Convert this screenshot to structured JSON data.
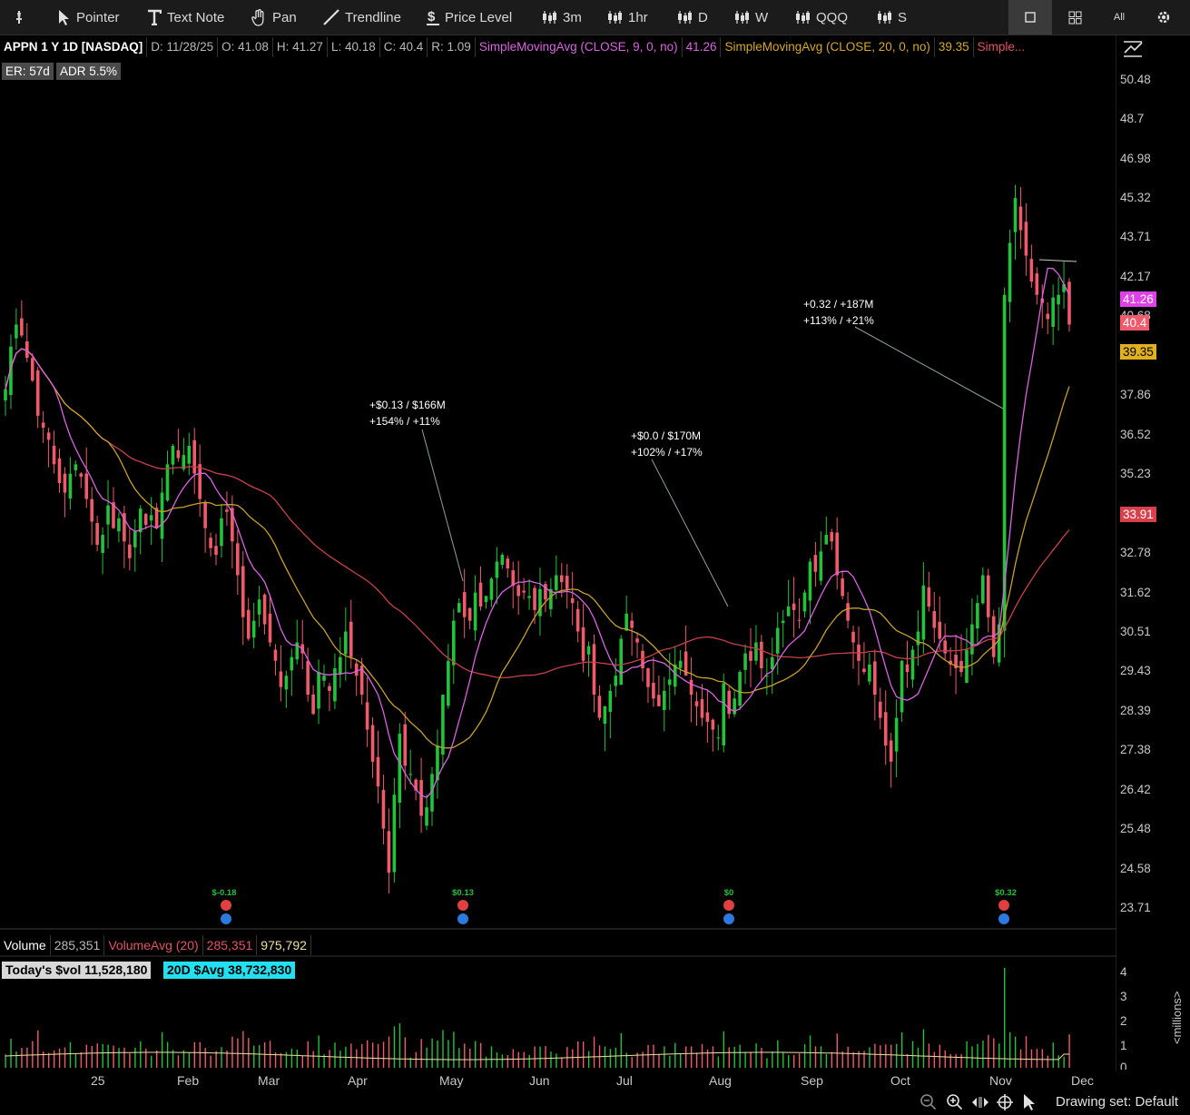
{
  "toolbar": {
    "pin_icon": "pin-icon",
    "pointer": "Pointer",
    "text_note": "Text Note",
    "pan": "Pan",
    "trendline": "Trendline",
    "price_level": "Price Level",
    "intervals": [
      "3m",
      "1hr",
      "D",
      "W",
      "QQQ",
      "S"
    ],
    "all_label": "All"
  },
  "info": {
    "symbol": "APPN 1 Y 1D [NASDAQ]",
    "date": "D: 11/28/25",
    "open": "O: 41.08",
    "high": "H: 41.27",
    "low": "L: 40.18",
    "close": "C: 40.4",
    "range": "R: 1.09",
    "sma9_label": "SimpleMovingAvg (CLOSE, 9, 0, no)",
    "sma9_value": "41.26",
    "sma20_label": "SimpleMovingAvg (CLOSE, 20, 0, no)",
    "sma20_value": "39.35",
    "sma50_label": "Simple...",
    "er": "ER: 57d",
    "adr": "ADR 5.5%"
  },
  "y_axis": [
    "50.48",
    "48.7",
    "46.98",
    "45.32",
    "43.71",
    "42.17",
    "40.68",
    "37.86",
    "36.52",
    "35.23",
    "32.78",
    "31.62",
    "30.51",
    "29.43",
    "28.39",
    "27.38",
    "26.42",
    "25.48",
    "24.58",
    "23.71"
  ],
  "price_tags": {
    "sma9": "41.26",
    "close": "40.4",
    "sma20": "39.35",
    "sma50": "33.91"
  },
  "annotations": [
    {
      "line1": "+$0.13 / $166M",
      "line2": "+154% / +11%"
    },
    {
      "line1": "+$0.0 / $170M",
      "line2": "+102% / +17%"
    },
    {
      "line1": "+0.32 / +187M",
      "line2": "+113% / +21%"
    }
  ],
  "earnings": [
    "$-0.18",
    "$0.13",
    "$0",
    "$0.32"
  ],
  "volume": {
    "label": "Volume",
    "value": "285,351",
    "avg_label": "VolumeAvg (20)",
    "avg_value": "285,351",
    "avg_value2": "975,792",
    "today_dollar": "Today's $vol 11,528,180",
    "avg_dollar": "20D $Avg 38,732,830",
    "axis": [
      "4",
      "3",
      "2",
      "1",
      "0"
    ],
    "unit": "<millions>"
  },
  "x_axis": [
    "25",
    "Feb",
    "Mar",
    "Apr",
    "May",
    "Jun",
    "Jul",
    "Aug",
    "Sep",
    "Oct",
    "Nov",
    "Dec"
  ],
  "status": {
    "drawing_set": "Drawing set: Default"
  },
  "colors": {
    "up": "#22c23a",
    "down": "#f05a6a",
    "sma9": "#d964e0",
    "sma20": "#c8a02a",
    "sma50": "#c8404a",
    "cyan": "#22e0f0"
  },
  "chart_data": {
    "type": "candlestick",
    "ylim": [
      23.4,
      51.5
    ],
    "close": [
      38.1,
      39.6,
      40.4,
      40.0,
      39.2,
      38.4,
      37.2,
      36.8,
      36.4,
      35.6,
      35.0,
      34.7,
      35.3,
      35.6,
      35.2,
      34.5,
      33.8,
      33.1,
      33.4,
      34.3,
      33.6,
      33.9,
      33.2,
      32.7,
      33.5,
      34.2,
      33.7,
      34.0,
      33.6,
      34.7,
      35.6,
      36.2,
      35.8,
      35.9,
      36.2,
      35.3,
      34.5,
      33.6,
      33.0,
      32.8,
      33.9,
      34.1,
      33.2,
      32.2,
      31.0,
      30.4,
      30.9,
      31.5,
      30.8,
      30.3,
      29.8,
      29.1,
      29.4,
      29.9,
      30.3,
      30.0,
      28.9,
      28.4,
      29.5,
      29.4,
      29.0,
      29.6,
      29.9,
      30.6,
      29.9,
      29.4,
      28.9,
      28.0,
      27.2,
      26.6,
      25.6,
      24.6,
      26.4,
      27.9,
      27.1,
      26.9,
      26.5,
      25.9,
      26.1,
      26.9,
      27.6,
      28.9,
      29.8,
      30.9,
      31.4,
      31.0,
      30.9,
      31.7,
      31.3,
      31.6,
      32.1,
      32.6,
      32.8,
      32.4,
      31.9,
      31.6,
      31.7,
      31.6,
      31.2,
      31.8,
      31.5,
      31.8,
      32.2,
      32.0,
      31.8,
      31.4,
      30.6,
      29.8,
      30.2,
      28.9,
      28.3,
      28.6,
      29.0,
      29.4,
      30.4,
      31.1,
      30.7,
      30.3,
      29.6,
      29.1,
      28.8,
      28.6,
      29.0,
      29.3,
      29.7,
      29.8,
      29.4,
      28.9,
      28.6,
      28.3,
      28.2,
      28.0,
      27.8,
      29.2,
      28.4,
      28.8,
      29.5,
      30.0,
      29.8,
      30.3,
      29.6,
      29.4,
      29.9,
      30.7,
      30.9,
      31.3,
      31.2,
      30.9,
      31.7,
      32.6,
      32.3,
      32.9,
      33.4,
      33.2,
      32.2,
      31.6,
      30.9,
      30.3,
      29.8,
      29.5,
      29.7,
      28.9,
      28.3,
      27.6,
      27.2,
      28.3,
      29.8,
      29.5,
      30.1,
      30.6,
      31.9,
      31.3,
      30.7,
      30.4,
      30.0,
      29.7,
      29.6,
      29.5,
      30.1,
      30.8,
      31.4,
      32.2,
      31.0,
      29.9,
      30.8,
      41.5,
      43.5,
      45.3,
      44.0,
      43.0,
      42.0,
      41.5,
      41.2,
      40.6,
      41.4,
      41.5,
      41.9,
      40.4
    ]
  }
}
